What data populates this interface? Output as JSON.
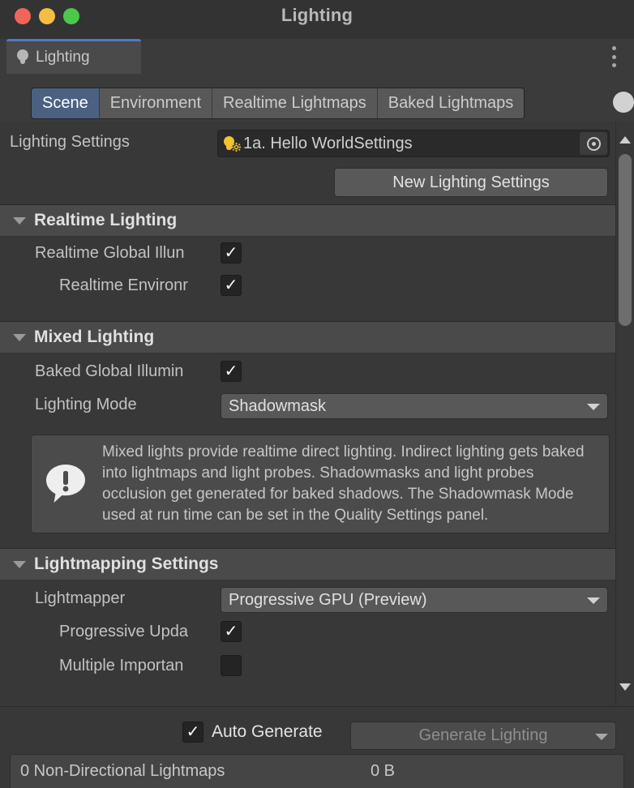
{
  "window": {
    "title": "Lighting",
    "traffic_lights": [
      "close",
      "minimize",
      "zoom"
    ]
  },
  "dock": {
    "tab_label": "Lighting",
    "tab_icon": "lightbulb-icon",
    "menu_icon": "kebab-menu-icon"
  },
  "tabs": [
    {
      "label": "Scene",
      "active": true
    },
    {
      "label": "Environment",
      "active": false
    },
    {
      "label": "Realtime Lightmaps",
      "active": false
    },
    {
      "label": "Baked Lightmaps",
      "active": false
    }
  ],
  "lighting_settings": {
    "label": "Lighting Settings",
    "asset_value": "1a. Hello WorldSettings",
    "asset_icon": "lighting-settings-asset-icon",
    "picker_icon": "object-picker-icon",
    "new_button": "New Lighting Settings"
  },
  "realtime_lighting": {
    "header": "Realtime Lighting",
    "rows": [
      {
        "label": "Realtime Global Illun",
        "checked": true
      },
      {
        "label": "Realtime Environr",
        "checked": true
      }
    ]
  },
  "mixed_lighting": {
    "header": "Mixed Lighting",
    "baked_gi": {
      "label": "Baked Global Illumin",
      "checked": true
    },
    "lighting_mode": {
      "label": "Lighting Mode",
      "value": "Shadowmask"
    },
    "info": "Mixed lights provide realtime direct lighting. Indirect lighting gets baked into lightmaps and light probes. Shadowmasks and light probes occlusion get generated for baked shadows. The Shadowmask Mode used at run time can be set in the Quality Settings panel.",
    "info_icon": "info-exclamation-icon"
  },
  "lightmapping_settings": {
    "header": "Lightmapping Settings",
    "lightmapper": {
      "label": "Lightmapper",
      "value": "Progressive GPU (Preview)"
    },
    "progressive_updates": {
      "label": "Progressive Upda",
      "checked": true
    },
    "multiple_importance": {
      "label": "Multiple Importan",
      "checked": false
    }
  },
  "bottom": {
    "auto_generate_label": "Auto Generate",
    "auto_generate_checked": true,
    "generate_button": "Generate Lighting",
    "generate_disabled": true
  },
  "status": {
    "lightmaps_text": "0 Non-Directional Lightmaps",
    "size_text": "0 B"
  },
  "scrollbar": {
    "up_icon": "scroll-up-arrow-icon",
    "down_icon": "scroll-down-arrow-icon"
  },
  "colors": {
    "accent_tab": "#4a6182",
    "dock_accent": "#4f7bbf",
    "panel_bg": "#383838",
    "header_bg": "#4a4a4a",
    "asset_icon": "#f2c230"
  },
  "checkmark": "✓"
}
